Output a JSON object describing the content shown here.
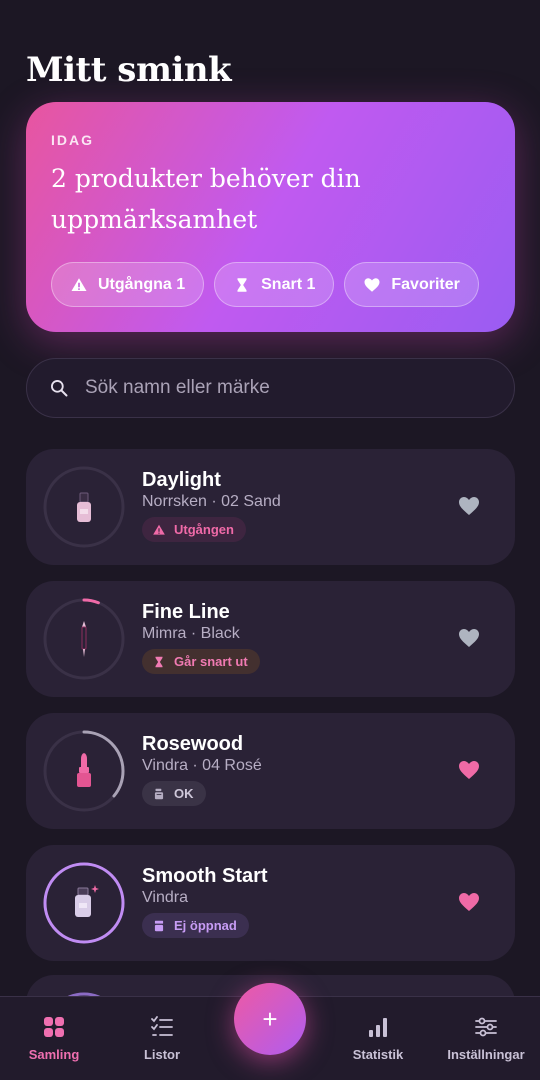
{
  "page": {
    "title": "Mitt smink"
  },
  "today": {
    "kicker": "IDAG",
    "headline": "2 produkter behöver din uppmärksamhet",
    "chips": [
      {
        "icon": "warning-icon",
        "label": "Utgångna 1"
      },
      {
        "icon": "hourglass-icon",
        "label": "Snart 1"
      },
      {
        "icon": "heart-icon",
        "label": "Favoriter"
      }
    ]
  },
  "search": {
    "placeholder": "Sök namn eller märke",
    "value": ""
  },
  "products": [
    {
      "name": "Daylight",
      "brand": "Norrsken · 02 Sand",
      "status": "Utgången",
      "status_icon": "warning-icon",
      "status_color": "#f06aa8",
      "icon": "foundation-bottle-icon",
      "used_fraction": 0,
      "favorite": false
    },
    {
      "name": "Fine Line",
      "brand": "Mimra · Black",
      "status": "Går snart ut",
      "status_icon": "hourglass-icon",
      "status_color": "#f07ab2",
      "icon": "eyeliner-icon",
      "used_fraction": 0.06,
      "favorite": false
    },
    {
      "name": "Rosewood",
      "brand": "Vindra · 04 Rosé",
      "status": "OK",
      "status_icon": "jar-icon",
      "status_color": "#cfc8da",
      "icon": "lipstick-icon",
      "used_fraction": 0.36,
      "favorite": true
    },
    {
      "name": "Smooth Start",
      "brand": "Vindra",
      "status": "Ej öppnad",
      "status_icon": "sealed-jar-icon",
      "status_color": "#c79cf5",
      "icon": "primer-bottle-icon",
      "used_fraction": 1,
      "favorite": true
    }
  ],
  "nav": {
    "items": [
      {
        "label": "Samling",
        "icon": "grid-icon",
        "active": true
      },
      {
        "label": "Listor",
        "icon": "checklist-icon",
        "active": false
      },
      {
        "label": "Statistik",
        "icon": "bar-chart-icon",
        "active": false
      },
      {
        "label": "Inställningar",
        "icon": "sliders-icon",
        "active": false
      }
    ],
    "add_label": "+"
  },
  "colors": {
    "accent": "#ef6fb0",
    "purple": "#b05cf0",
    "background": "#1c1724",
    "card": "#2a2236"
  }
}
